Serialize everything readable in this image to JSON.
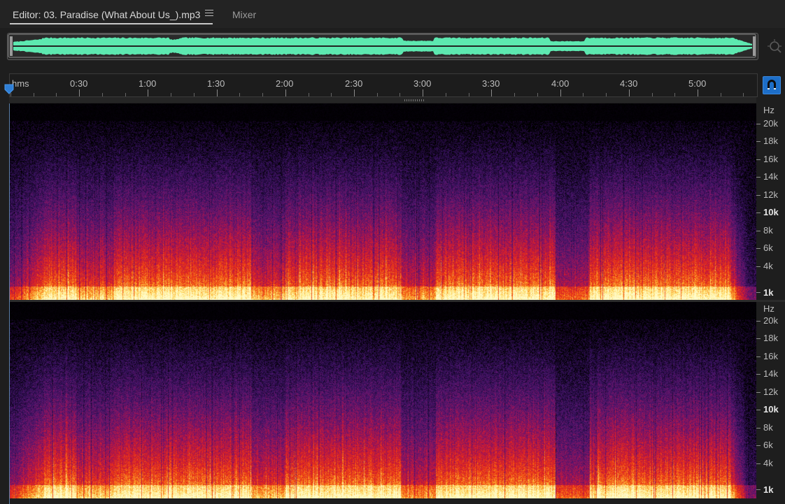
{
  "tabs": {
    "editor_label": "Editor: 03. Paradise (What About Us_).mp3",
    "mixer_label": "Mixer"
  },
  "ruler": {
    "unit": "hms",
    "labels": [
      "0:30",
      "1:00",
      "1:30",
      "2:00",
      "2:30",
      "3:00",
      "3:30",
      "4:00",
      "4:30",
      "5:00"
    ]
  },
  "frequency_axis": {
    "unit": "Hz",
    "labels": [
      "20k",
      "18k",
      "16k",
      "14k",
      "12k",
      "10k",
      "8k",
      "6k",
      "4k",
      "1k"
    ]
  },
  "icons": {
    "zoom": "zoom-to-selection-icon",
    "snap": "snap-magnet-icon",
    "playhead": "playhead-marker-icon",
    "menu": "hamburger-menu-icon"
  },
  "colors": {
    "waveform": "#5de8b0",
    "spectral_low": "#ffe27a",
    "spectral_mid": "#e32a1a",
    "spectral_high": "#3a1760",
    "accent": "#1d6ec8"
  }
}
